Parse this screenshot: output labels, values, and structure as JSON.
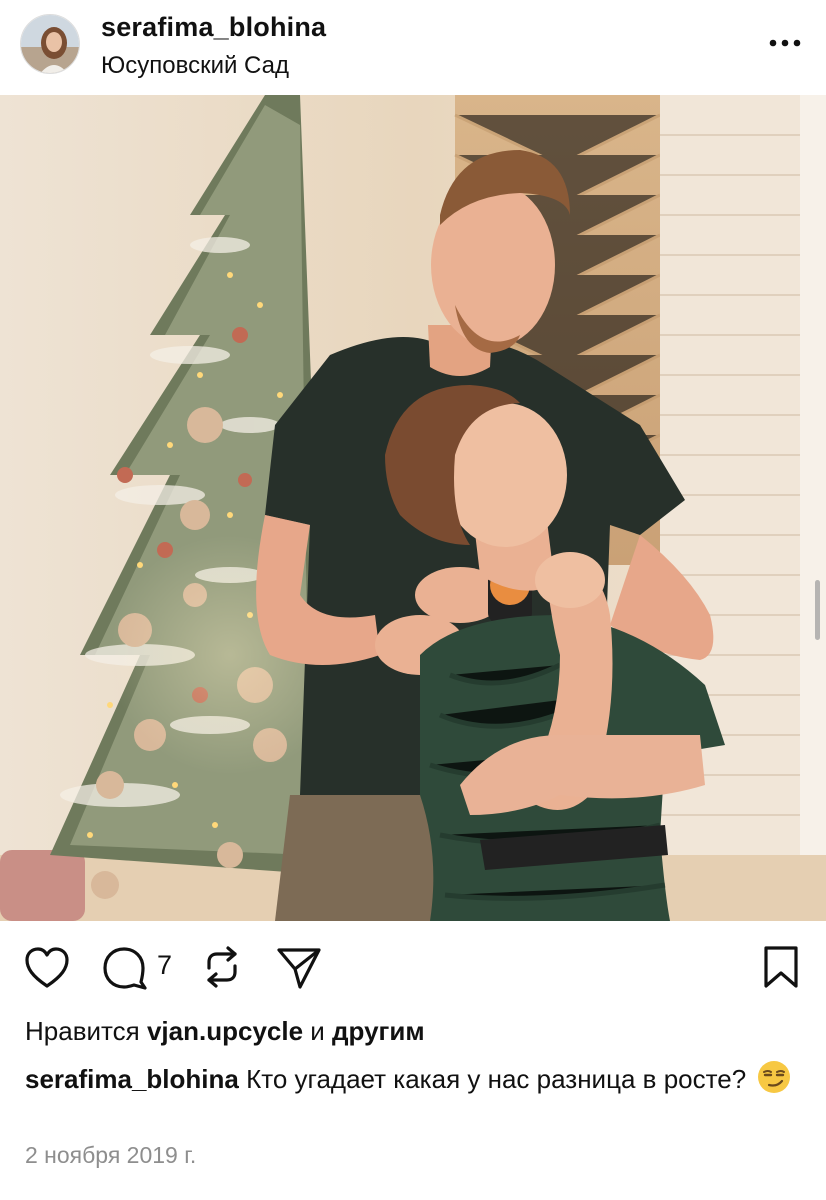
{
  "post": {
    "username": "serafima_blohina",
    "location": "Юсуповский Сад",
    "comment_count": "7",
    "likes_prefix": "Нравится",
    "likes_user": "vjan.upcycle",
    "likes_and": "и",
    "likes_others": "другим",
    "caption_user": "serafima_blohina",
    "caption_text": "Кто угадает какая у нас разница в росте?",
    "date": "2 ноября 2019 г."
  },
  "icons": {
    "more": "more-dots-icon",
    "like": "heart-icon",
    "comment": "comment-icon",
    "repost": "repost-icon",
    "share": "send-icon",
    "save": "bookmark-icon",
    "emoji": "smirking-face-emoji"
  },
  "colors": {
    "text": "#111111",
    "secondary_text": "#8e8e8e",
    "background": "#ffffff"
  }
}
